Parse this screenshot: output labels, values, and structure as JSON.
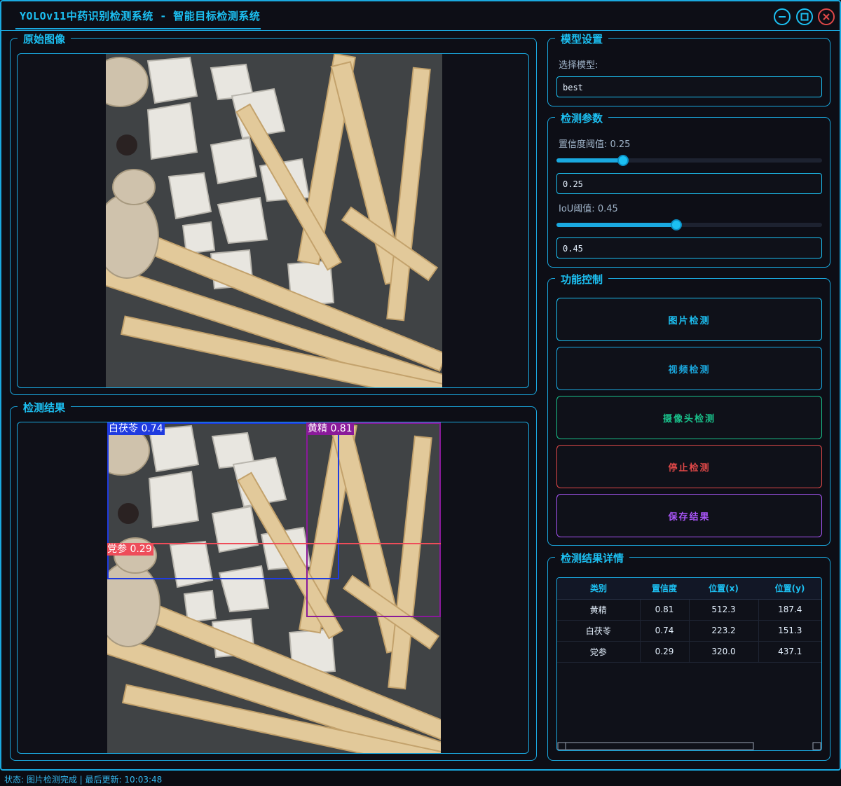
{
  "window": {
    "title": "YOLOv11中药识别检测系统 - 智能目标检测系统",
    "minimize_icon": "minimize-icon",
    "maximize_icon": "maximize-icon",
    "close_icon": "close-icon"
  },
  "original_panel": {
    "label": "原始图像"
  },
  "result_panel": {
    "label": "检测结果",
    "detections": [
      {
        "label": "白茯苓 0.74",
        "color": "#1f3be0"
      },
      {
        "label": "黄精 0.81",
        "color": "#8a1a9a"
      },
      {
        "label": "党参 0.29",
        "color": "#ee4d5a"
      }
    ]
  },
  "model_settings": {
    "label": "模型设置",
    "select_label": "选择模型:",
    "model_value": "best"
  },
  "detect_params": {
    "label": "检测参数",
    "conf_label": "置信度阈值: 0.25",
    "conf_value": "0.25",
    "conf_level": 0.25,
    "iou_label": "IoU阈值: 0.45",
    "iou_value": "0.45",
    "iou_level": 0.45
  },
  "controls": {
    "label": "功能控制",
    "buttons": [
      {
        "label": "图片检测",
        "color": "#1cc0f2"
      },
      {
        "label": "视频检测",
        "color": "#1aa9e0"
      },
      {
        "label": "摄像头检测",
        "color": "#19c08a"
      },
      {
        "label": "停止检测",
        "color": "#e04848"
      },
      {
        "label": "保存结果",
        "color": "#a855f7"
      }
    ]
  },
  "details": {
    "label": "检测结果详情",
    "columns": [
      "类别",
      "置信度",
      "位置(x)",
      "位置(y)"
    ],
    "rows": [
      [
        "黄精",
        "0.81",
        "512.3",
        "187.4"
      ],
      [
        "白茯苓",
        "0.74",
        "223.2",
        "151.3"
      ],
      [
        "党参",
        "0.29",
        "320.0",
        "437.1"
      ]
    ]
  },
  "status": "状态: 图片检测完成 | 最后更新: 10:03:48",
  "colors": {
    "accent": "#1aa9e0",
    "background": "#0d0e16"
  }
}
